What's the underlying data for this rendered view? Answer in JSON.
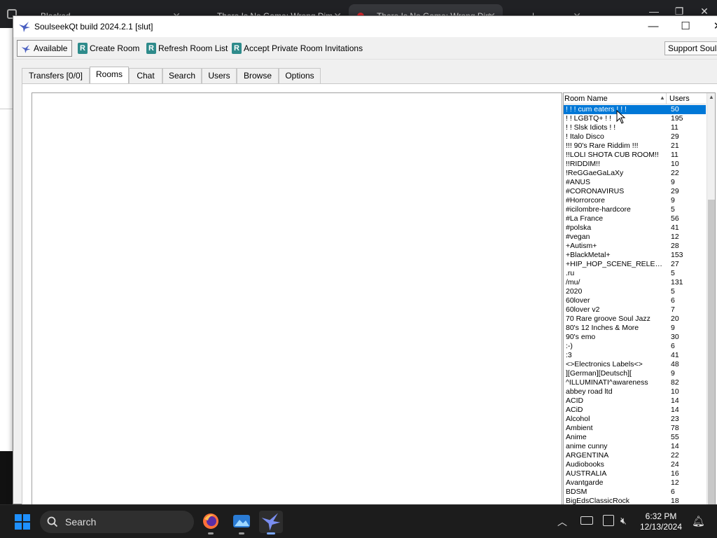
{
  "background": {
    "tabs": [
      {
        "label": "Blocked"
      },
      {
        "label": "There Is No Game: Wrong Dim"
      },
      {
        "label": "There Is No Game: Wrong Dim"
      },
      {
        "label": "|"
      }
    ]
  },
  "window": {
    "title": "SoulseekQt build 2024.2.1 [slut]",
    "controls": {
      "minimize": "—",
      "maximize": "☐",
      "close": "✕"
    }
  },
  "toolbar": {
    "status": "Available",
    "create_room": "Create Room",
    "refresh_room_list": "Refresh Room List",
    "accept_private": "Accept Private Room Invitations",
    "support": "Support Soulseek"
  },
  "tabs": [
    {
      "label": "Transfers [0/0]",
      "active": false
    },
    {
      "label": "Rooms",
      "active": true
    },
    {
      "label": "Chat",
      "active": false
    },
    {
      "label": "Search",
      "active": false
    },
    {
      "label": "Users",
      "active": false
    },
    {
      "label": "Browse",
      "active": false
    },
    {
      "label": "Options",
      "active": false
    }
  ],
  "room_list": {
    "columns": {
      "name": "Room Name",
      "users": "Users"
    },
    "rows": [
      {
        "name": "! ! ! cum eaters ! ! !",
        "users": "50",
        "selected": true
      },
      {
        "name": "! ! LGBTQ+ ! !",
        "users": "195"
      },
      {
        "name": "! ! Slsk Idiots ! !",
        "users": "11"
      },
      {
        "name": "! Italo Disco",
        "users": "29"
      },
      {
        "name": "!!! 90's Rare Riddim !!!",
        "users": "21"
      },
      {
        "name": "!!LOLI SHOTA CUB ROOM!!",
        "users": "11"
      },
      {
        "name": "!!RIDDIM!!",
        "users": "10"
      },
      {
        "name": "!ReGGaeGaLaXy",
        "users": "22"
      },
      {
        "name": "#ANUS",
        "users": "9"
      },
      {
        "name": "#CORONAVIRUS",
        "users": "29"
      },
      {
        "name": "#Horrorcore",
        "users": "9"
      },
      {
        "name": "#icilombre-hardcore",
        "users": "5"
      },
      {
        "name": "#La France",
        "users": "56"
      },
      {
        "name": "#polska",
        "users": "41"
      },
      {
        "name": "#vegan",
        "users": "12"
      },
      {
        "name": "+Autism+",
        "users": "28"
      },
      {
        "name": "+BlackMetal+",
        "users": "153"
      },
      {
        "name": "+HIP_HOP_SCENE_RELEASES+",
        "users": "27"
      },
      {
        "name": ".ru",
        "users": "5"
      },
      {
        "name": "/mu/",
        "users": "131"
      },
      {
        "name": "2020",
        "users": "5"
      },
      {
        "name": "60lover",
        "users": "6"
      },
      {
        "name": "60lover v2",
        "users": "7"
      },
      {
        "name": "70 Rare groove Soul Jazz",
        "users": "20"
      },
      {
        "name": "80's 12 Inches & More",
        "users": "9"
      },
      {
        "name": "90's emo",
        "users": "30"
      },
      {
        "name": ":-)",
        "users": "6"
      },
      {
        "name": ":3",
        "users": "41"
      },
      {
        "name": "<>Electronics Labels<>",
        "users": "48"
      },
      {
        "name": "][German][Deutsch][",
        "users": "9"
      },
      {
        "name": "^ILLUMINATI^awareness",
        "users": "82"
      },
      {
        "name": "abbey road ltd",
        "users": "10"
      },
      {
        "name": "ACID",
        "users": "14"
      },
      {
        "name": "ACiD",
        "users": "14"
      },
      {
        "name": "Alcohol",
        "users": "23"
      },
      {
        "name": "Ambient",
        "users": "78"
      },
      {
        "name": "Anime",
        "users": "55"
      },
      {
        "name": "anime cunny",
        "users": "14"
      },
      {
        "name": "ARGENTINA",
        "users": "22"
      },
      {
        "name": "Audiobooks",
        "users": "24"
      },
      {
        "name": "AUSTRALIA",
        "users": "16"
      },
      {
        "name": "Avantgarde",
        "users": "12"
      },
      {
        "name": "BDSM",
        "users": "6"
      },
      {
        "name": "BigEdsClassicRock",
        "users": "18"
      }
    ]
  },
  "taskbar": {
    "search_label": "Search",
    "time": "6:32 PM",
    "date": "12/13/2024"
  },
  "colors": {
    "selection": "#0078d7",
    "taskbar": "#1c1c1c",
    "room_icon": "#2e8b8b"
  }
}
